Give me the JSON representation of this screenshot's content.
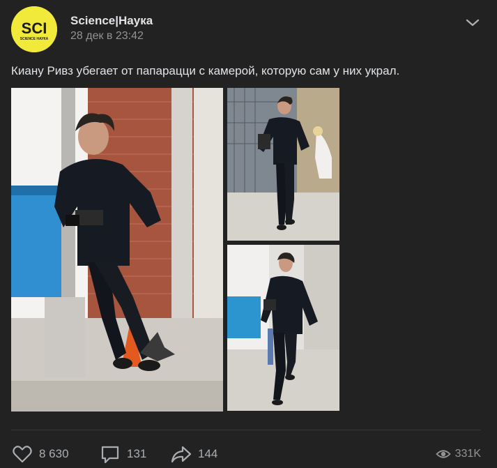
{
  "post": {
    "author": "Science|Наука",
    "avatar_text": "SCI",
    "avatar_subtext": "SCIENCE НАУКА",
    "date": "28 дек в 23:42",
    "more_icon": "chevron-down-icon",
    "text": "Киану Ривз убегает от папарацци с камерой, которую сам у них украл.",
    "accent_color": "#f2ea3a"
  },
  "photos": [
    {
      "alt": "photo-1"
    },
    {
      "alt": "photo-2"
    },
    {
      "alt": "photo-3"
    }
  ],
  "footer": {
    "likes": "8 630",
    "comments": "131",
    "shares": "144",
    "views": "331K",
    "like_icon": "heart-icon",
    "comment_icon": "comment-icon",
    "share_icon": "share-icon",
    "views_icon": "eye-icon"
  }
}
